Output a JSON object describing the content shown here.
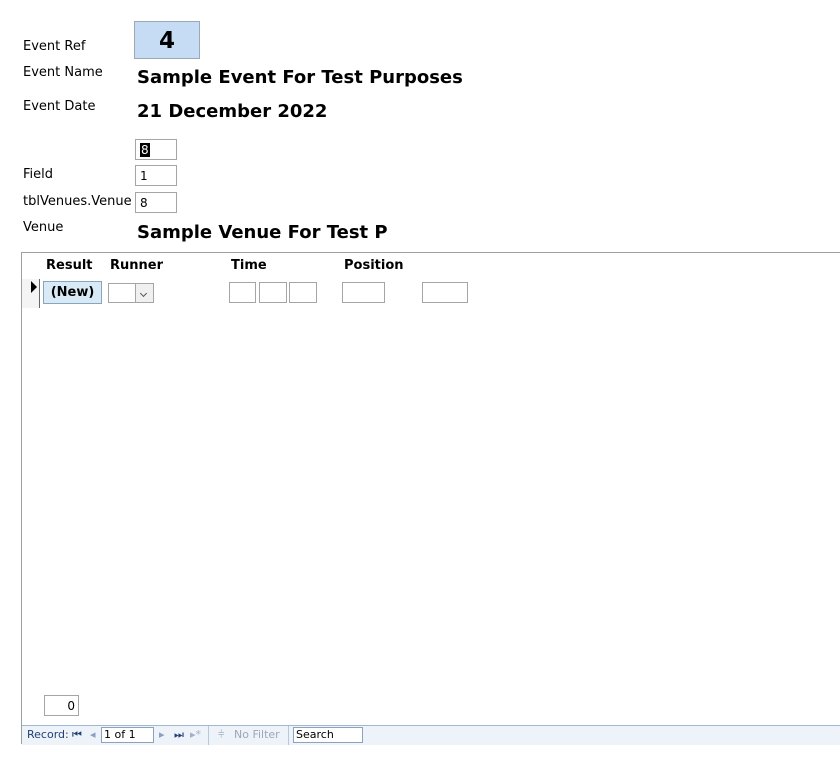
{
  "header": {
    "event_ref_label": "Event Ref",
    "event_ref_value": "4",
    "event_name_label": "Event Name",
    "event_name_value": "Sample Event For Test Purposes",
    "event_date_label": "Event Date",
    "event_date_value": "21 December 2022",
    "unlabeled_field_value": "8",
    "field_label": "Field",
    "field_value": "1",
    "venue_id_label": "tblVenues.Venue",
    "venue_id_value": "8",
    "venue_label": "Venue",
    "venue_value": "Sample Venue For Test P"
  },
  "subform": {
    "columns": [
      "Result",
      "Runner",
      "Time",
      "Position"
    ],
    "new_label": "(New)",
    "total_value": "0"
  },
  "navigation": {
    "record_label": "Record:",
    "position": "1 of 1",
    "filter_label": "No Filter",
    "search_label": "Search"
  },
  "colors": {
    "ref_box_bg": "#c6dcf5",
    "new_button_bg": "#d9eaf7",
    "nav_bg": "#eef3fa"
  }
}
